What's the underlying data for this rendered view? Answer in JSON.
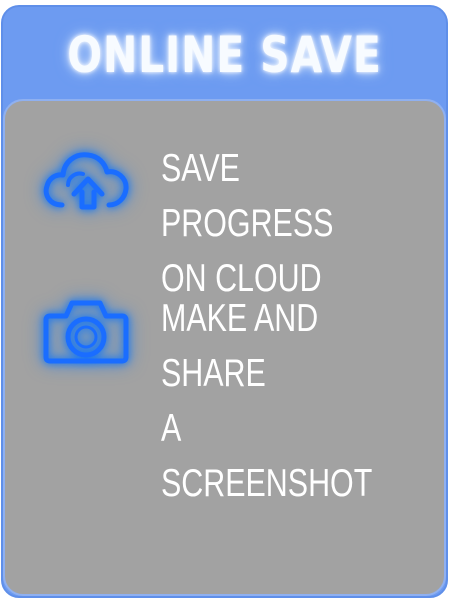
{
  "panel": {
    "title": "ONLINE SAVE",
    "features": [
      {
        "icon": "cloud-upload-icon",
        "label": "SAVE PROGRESS\nON CLOUD"
      },
      {
        "icon": "camera-icon",
        "label": "MAKE AND SHARE\nA SCREENSHOT"
      }
    ]
  },
  "colors": {
    "header": "#6d9bf1",
    "body": "#a2a2a2",
    "icon": "#1769ff",
    "text": "#ffffff"
  }
}
